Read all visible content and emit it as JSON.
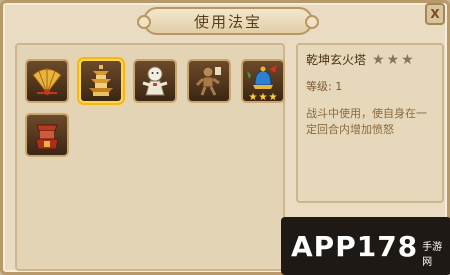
{
  "window": {
    "title": "使用法宝",
    "close_label": "X"
  },
  "inventory": {
    "slots": [
      {
        "icon": "golden-fan-icon",
        "selected": false,
        "stars": 0
      },
      {
        "icon": "pagoda-icon",
        "selected": true,
        "stars": 0
      },
      {
        "icon": "white-doll-icon",
        "selected": false,
        "stars": 0
      },
      {
        "icon": "wooden-puppet-icon",
        "selected": false,
        "stars": 0
      },
      {
        "icon": "bell-icon",
        "selected": false,
        "stars": 3
      },
      {
        "icon": "red-tower-icon",
        "selected": false,
        "stars": 0
      }
    ]
  },
  "detail": {
    "name": "乾坤玄火塔",
    "star_count": 3,
    "level_label": "等级: 1",
    "description": "战斗中使用，使自身在一定回合内增加愤怒"
  },
  "watermark": {
    "text": "APP178",
    "sub": "手游网"
  },
  "colors": {
    "star_gold": "#ffd23a",
    "star_dim": "#8a7458",
    "accent": "#ffd94a"
  }
}
